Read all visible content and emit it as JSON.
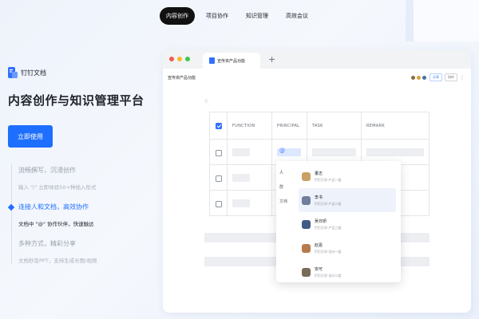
{
  "nav": {
    "tabs": [
      {
        "label": "内容创作",
        "active": true
      },
      {
        "label": "项目协作",
        "active": false
      },
      {
        "label": "知识管理",
        "active": false
      },
      {
        "label": "高效会议",
        "active": false
      }
    ]
  },
  "hero": {
    "brand_name": "钉钉文档",
    "title": "内容创作与知识管理平台",
    "cta_label": "立即使用",
    "features": [
      {
        "title": "流畅撰写，沉浸创作",
        "subtitle": "输入 \"/\" 立即体验50+种插入形式",
        "active": false
      },
      {
        "title": "连接人和文档，高效协作",
        "subtitle": "文档中 \"@\" 协作伙伴，快速触达",
        "active": true
      },
      {
        "title": "多种方式，精彩分享",
        "subtitle": "文档秒变PPT，支持生成长图/视频",
        "active": false
      }
    ]
  },
  "window": {
    "tab_label": "宣传资产品功能",
    "plus": "+",
    "breadcrumb": "宣传资产品功能",
    "pills": [
      "分享",
      "协作"
    ],
    "more": "⋮",
    "grip": "⠿",
    "table": {
      "headers": [
        "",
        "FUNCTION",
        "PRINCIPAL",
        "TASK",
        "REMARK"
      ]
    },
    "mention_popup": {
      "categories": [
        {
          "label": "人",
          "selected": true
        },
        {
          "label": "群",
          "selected": false
        },
        {
          "label": "文档",
          "selected": false
        }
      ],
      "people": [
        {
          "name": "董志",
          "title": "钉钉大学-产品一组",
          "color": "#c9a066",
          "highlighted": false
        },
        {
          "name": "李书",
          "title": "钉钉大学-产品二组",
          "color": "#6d7f99",
          "highlighted": true
        },
        {
          "name": "吴日妍",
          "title": "钉钉大学-产品三组",
          "color": "#3f5a85",
          "highlighted": false
        },
        {
          "name": "赵嘉",
          "title": "钉钉大学-设计一组",
          "color": "#b77b4b",
          "highlighted": false
        },
        {
          "name": "安可",
          "title": "钉钉大学-设计二组",
          "color": "#7a6a5a",
          "highlighted": false
        }
      ]
    }
  },
  "colors": {
    "accent": "#1f6fff",
    "nav_active_bg": "#111111",
    "doc_blue": "#3370ff"
  }
}
